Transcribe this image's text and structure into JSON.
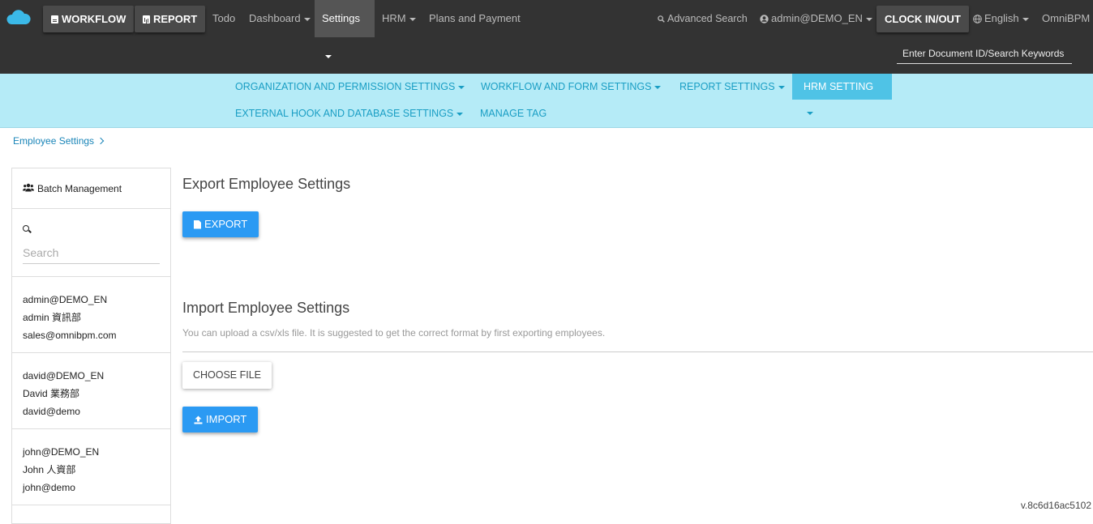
{
  "topbar": {
    "workflow_label": "WORKFLOW",
    "report_label": "REPORT",
    "nav": [
      {
        "label": "Todo",
        "dropdown": false
      },
      {
        "label": "Dashboard",
        "dropdown": true
      },
      {
        "label": "Settings",
        "dropdown": true,
        "active": true
      },
      {
        "label": "HRM",
        "dropdown": true
      },
      {
        "label": "Plans and Payment",
        "dropdown": false
      }
    ],
    "advanced_search": "Advanced Search",
    "user": "admin@DEMO_EN",
    "clock_label": "CLOCK IN/OUT",
    "language": "English",
    "brand": "OmniBPM",
    "search_placeholder": "Enter Document ID/Search Keywords"
  },
  "subnav": [
    {
      "label": "ORGANIZATION AND PERMISSION SETTINGS",
      "dropdown": true
    },
    {
      "label": "WORKFLOW AND FORM SETTINGS",
      "dropdown": true
    },
    {
      "label": "REPORT SETTINGS",
      "dropdown": true
    },
    {
      "label": "HRM SETTING",
      "dropdown": true,
      "active": true
    },
    {
      "label": "EXTERNAL HOOK AND DATABASE SETTINGS",
      "dropdown": true
    },
    {
      "label": "MANAGE TAG",
      "dropdown": false
    }
  ],
  "breadcrumb": "Employee Settings",
  "sidebar": {
    "batch_label": "Batch Management",
    "search_placeholder": "Search",
    "users": [
      {
        "account": "admin@DEMO_EN",
        "name": "admin 資訊部",
        "email": "sales@omnibpm.com"
      },
      {
        "account": "david@DEMO_EN",
        "name": "David 業務部",
        "email": "david@demo"
      },
      {
        "account": "john@DEMO_EN",
        "name": "John 人資部",
        "email": "john@demo"
      }
    ]
  },
  "export": {
    "title": "Export Employee Settings",
    "button": "EXPORT"
  },
  "import": {
    "title": "Import Employee Settings",
    "hint": "You can upload a csv/xls file. It is suggested to get the correct format by first exporting employees.",
    "choose_button": "CHOOSE FILE",
    "import_button": "IMPORT"
  },
  "version": "v.8c6d16ac5102",
  "colors": {
    "topbar": "#333333",
    "subbar": "#b5ebf7",
    "accent": "#2b9af3",
    "link": "#1a9ec4"
  }
}
